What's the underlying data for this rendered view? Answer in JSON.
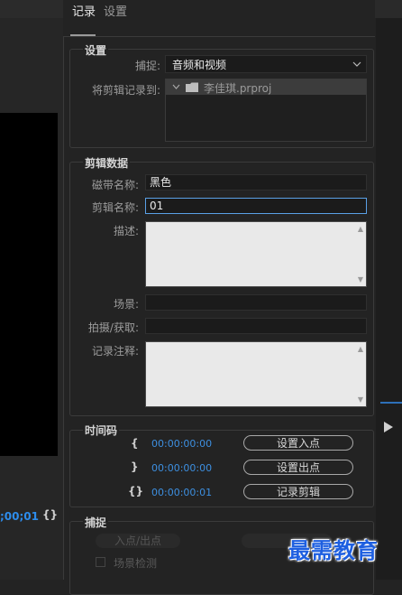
{
  "left": {
    "timecode": ";00;01",
    "brace": "{}"
  },
  "tabs": [
    {
      "label": "记录"
    },
    {
      "label": "设置"
    }
  ],
  "settings": {
    "title": "设置",
    "capture_label": "捕捉:",
    "capture_value": "音频和视频",
    "log_to_label": "将剪辑记录到:",
    "project_item": "李佳琪.prproj"
  },
  "clip_data": {
    "title": "剪辑数据",
    "tape_name_label": "磁带名称:",
    "tape_name_value": "黑色",
    "clip_name_label": "剪辑名称:",
    "clip_name_value": "01",
    "description_label": "描述:",
    "scene_label": "场景:",
    "shot_label": "拍摄/获取:",
    "log_note_label": "记录注释:"
  },
  "timecode": {
    "title": "时间码",
    "in_value": "00:00:00:00",
    "out_value": "00:00:00:00",
    "duration_value": "00:00:00:01",
    "in_brace": "{",
    "out_brace": "}",
    "dur_brace": "{}",
    "set_in_label": "设置入点",
    "set_out_label": "设置出点",
    "log_clip_label": "记录剪辑"
  },
  "capture": {
    "title": "捕捉",
    "in_out_label": "入点/出点",
    "scene_detect_label": "场景检测"
  },
  "watermark": "最需教育"
}
